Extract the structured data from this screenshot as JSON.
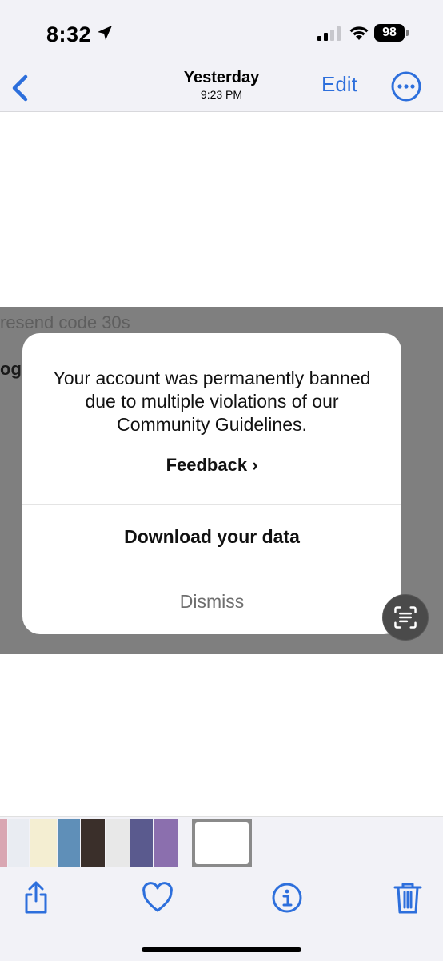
{
  "status_bar": {
    "time": "8:32",
    "battery": "98"
  },
  "nav": {
    "title": "Yesterday",
    "subtitle": "9:23 PM",
    "edit_label": "Edit"
  },
  "background_text": {
    "resend": "resend code   30s",
    "og": "og"
  },
  "dialog": {
    "message": "Your account was permanently banned due to multiple violations of our Community Guidelines.",
    "feedback_label": "Feedback",
    "download_label": "Download your data",
    "dismiss_label": "Dismiss"
  },
  "icons": {
    "back": "chevron-left-icon",
    "more": "ellipsis-circle-icon",
    "share": "share-icon",
    "favorite": "heart-icon",
    "info": "info-icon",
    "delete": "trash-icon",
    "live_text": "live-text-icon"
  },
  "colors": {
    "accent": "#2d6fdc",
    "overlay": "#7f7f7f",
    "bar_background": "#f2f2f7"
  }
}
